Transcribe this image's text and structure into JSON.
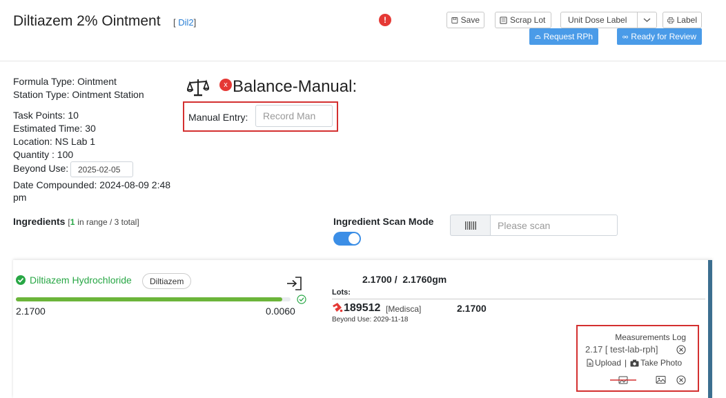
{
  "header": {
    "title": "Diltiazem 2% Ointment",
    "code_open": "[",
    "code_link": "Dil2",
    "code_close": "]",
    "alert_glyph": "!",
    "buttons": {
      "save": "Save",
      "scrap_lot": "Scrap Lot",
      "unit_dose_label": "Unit Dose Label",
      "label": "Label",
      "request_rph": "Request RPh",
      "ready_for_review": "Ready for Review"
    }
  },
  "info": {
    "formula_type": "Formula Type: Ointment",
    "station_type": "Station Type: Ointment Station",
    "task_points": "Task Points: 10",
    "estimated_time": "Estimated Time: 30",
    "location": "Location: NS Lab 1",
    "quantity": "Quantity : 100",
    "beyond_use_label": "Beyond Use:",
    "beyond_use_value": "2025-02-05",
    "date_compounded_line1": "Date Compounded: 2024-08-09 2:48",
    "date_compounded_line2": "pm"
  },
  "balance": {
    "close_glyph": "x",
    "title": "Balance-Manual:",
    "manual_entry_label": "Manual Entry:",
    "manual_entry_placeholder": "Record Man"
  },
  "ingredients": {
    "label": "Ingredients",
    "open_bracket": "[",
    "in_range_count": "1",
    "summary_rest": "in range / 3 total]"
  },
  "scan": {
    "mode_label": "Ingredient Scan Mode",
    "toggle_on": true,
    "placeholder": "Please scan"
  },
  "ingredient_card": {
    "name": "Diltiazem Hydrochloride",
    "tag": "Diltiazem",
    "progress_fraction": 0.97,
    "left_value": "2.1700",
    "right_value": "0.0060",
    "target_text": "2.1700 /  2.1760gm",
    "lots_label": "Lots:",
    "lot_number": "189512",
    "lot_supplier": "[Medisca]",
    "lot_amount": "2.1700",
    "lot_beyond_use": "Beyond Use: 2029-11-18",
    "log_title": "Measurements Log",
    "log_entry": "2.17 [ test-lab-rph]",
    "upload": "Upload",
    "separator": "|",
    "take_photo": "Take Photo"
  },
  "colors": {
    "accent_blue": "#4a9be8",
    "success_green": "#28a745",
    "progress_green": "#6bb53a",
    "danger_red": "#e53935",
    "annotation_red": "#d32f2f",
    "toggle_blue": "#3b8ee6",
    "scrollbar": "#3b6e8f"
  }
}
